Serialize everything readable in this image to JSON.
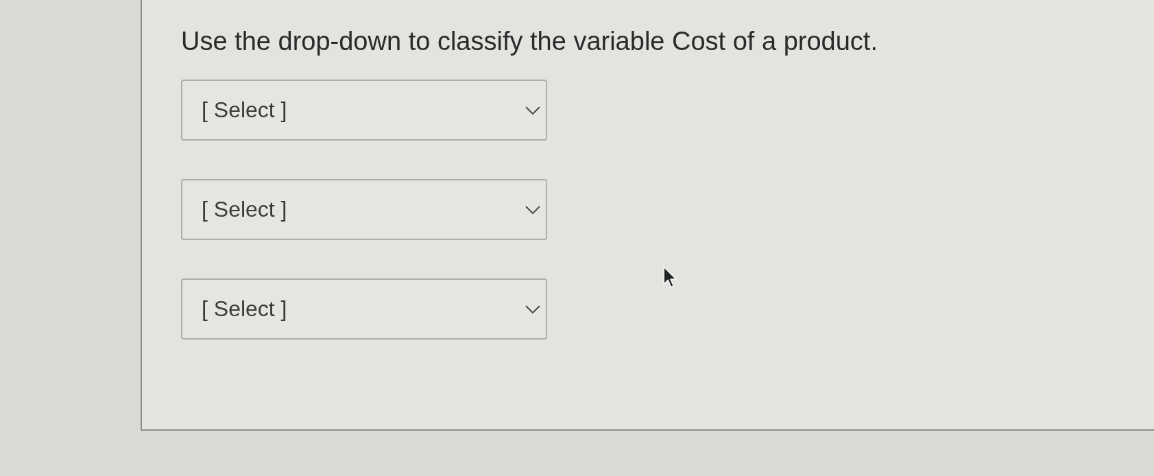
{
  "question": {
    "text": "Use the drop-down to classify the variable Cost of a product."
  },
  "dropdowns": [
    {
      "placeholder": "[ Select ]"
    },
    {
      "placeholder": "[ Select ]"
    },
    {
      "placeholder": "[ Select ]"
    }
  ]
}
